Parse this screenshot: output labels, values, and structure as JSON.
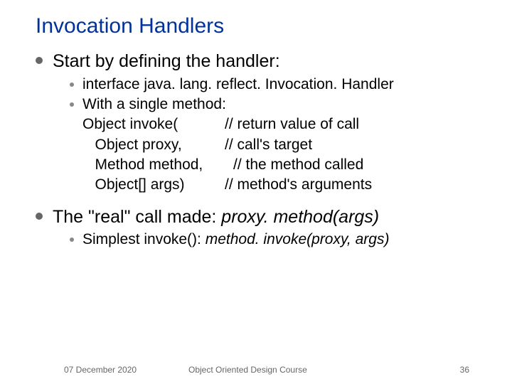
{
  "title": "Invocation Handlers",
  "b1": {
    "text": "Start by defining the handler:",
    "s1": "interface java. lang. reflect. Invocation. Handler",
    "s2": "With a single method:",
    "code": {
      "l1a": "Object invoke(",
      "l1b": "// return value of call",
      "l2a": "   Object proxy,",
      "l2b": "// call's target",
      "l3a": "   Method method,",
      "l3b": "// the method called",
      "l4a": "   Object[] args)",
      "l4b": "// method's arguments"
    }
  },
  "b2": {
    "prefix": "The \"real\" call made: ",
    "italic": "proxy. method(args)",
    "s1_prefix": "Simplest invoke(): ",
    "s1_italic": "method. invoke(proxy, args)"
  },
  "footer": {
    "date": "07 December 2020",
    "center": "Object Oriented Design Course",
    "num": "36"
  }
}
